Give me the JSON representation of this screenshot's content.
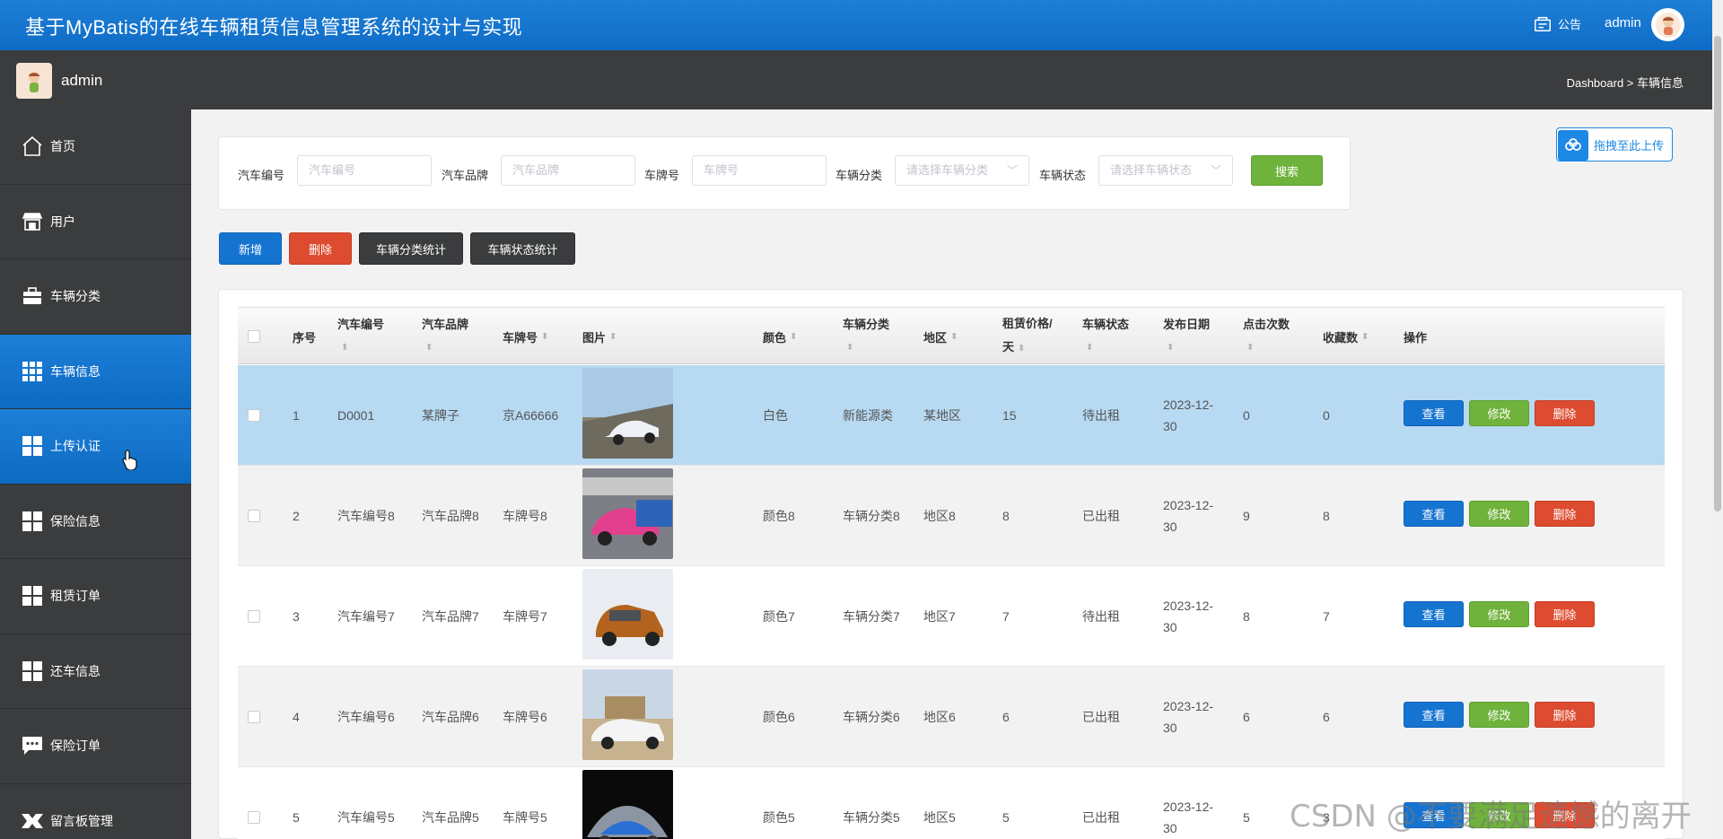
{
  "header": {
    "title": "基于MyBatis的在线车辆租赁信息管理系统的设计与实现",
    "notice_label": "公告",
    "user": "admin"
  },
  "subbar": {
    "user": "admin",
    "breadcrumb": "Dashboard > 车辆信息"
  },
  "sidebar": {
    "items": [
      {
        "label": "首页",
        "icon": "home-icon"
      },
      {
        "label": "用户",
        "icon": "store-icon"
      },
      {
        "label": "车辆分类",
        "icon": "briefcase-icon"
      },
      {
        "label": "车辆信息",
        "icon": "grid9-icon"
      },
      {
        "label": "上传认证",
        "icon": "grid4-icon"
      },
      {
        "label": "保险信息",
        "icon": "grid4-icon"
      },
      {
        "label": "租赁订单",
        "icon": "grid4-icon"
      },
      {
        "label": "还车信息",
        "icon": "grid4-icon"
      },
      {
        "label": "保险订单",
        "icon": "chat-icon"
      },
      {
        "label": "留言板管理",
        "icon": "ribbon-icon"
      }
    ],
    "active_index": 3
  },
  "upload": {
    "label": "拖拽至此上传"
  },
  "search": {
    "fields": [
      {
        "label": "汽车编号",
        "placeholder": "汽车编号"
      },
      {
        "label": "汽车品牌",
        "placeholder": "汽车品牌"
      },
      {
        "label": "车牌号",
        "placeholder": "车牌号"
      }
    ],
    "selects": [
      {
        "label": "车辆分类",
        "placeholder": "请选择车辆分类"
      },
      {
        "label": "车辆状态",
        "placeholder": "请选择车辆状态"
      }
    ],
    "button": "搜索"
  },
  "actions": {
    "add": "新增",
    "delete": "删除",
    "category_stats": "车辆分类统计",
    "status_stats": "车辆状态统计"
  },
  "colors": {
    "primary": "#1674d1",
    "success": "#6fb23c",
    "danger": "#dd4b30",
    "dark": "#3a3c3d",
    "selected_row": "#b7d9f2"
  },
  "table": {
    "headers": {
      "index": "序号",
      "car_no": "汽车编号",
      "brand": "汽车品牌",
      "plate": "车牌号",
      "image": "图片",
      "color": "颜色",
      "category": "车辆分类",
      "region": "地区",
      "price_line1": "租赁价格/",
      "price_line2": "天",
      "status": "车辆状态",
      "date": "发布日期",
      "clicks": "点击次数",
      "favorites": "收藏数",
      "ops": "操作"
    },
    "row_buttons": {
      "view": "查看",
      "edit": "修改",
      "delete": "删除"
    },
    "rows": [
      {
        "index": "1",
        "car_no": "D0001",
        "brand": "某牌子",
        "plate": "京A66666",
        "color": "白色",
        "category": "新能源类",
        "region": "某地区",
        "price": "15",
        "status": "待出租",
        "date1": "2023-12-",
        "date2": "30",
        "clicks": "0",
        "favorites": "0"
      },
      {
        "index": "2",
        "car_no": "汽车编号8",
        "brand": "汽车品牌8",
        "plate": "车牌号8",
        "color": "颜色8",
        "category": "车辆分类8",
        "region": "地区8",
        "price": "8",
        "status": "已出租",
        "date1": "2023-12-",
        "date2": "30",
        "clicks": "9",
        "favorites": "8"
      },
      {
        "index": "3",
        "car_no": "汽车编号7",
        "brand": "汽车品牌7",
        "plate": "车牌号7",
        "color": "颜色7",
        "category": "车辆分类7",
        "region": "地区7",
        "price": "7",
        "status": "待出租",
        "date1": "2023-12-",
        "date2": "30",
        "clicks": "8",
        "favorites": "7"
      },
      {
        "index": "4",
        "car_no": "汽车编号6",
        "brand": "汽车品牌6",
        "plate": "车牌号6",
        "color": "颜色6",
        "category": "车辆分类6",
        "region": "地区6",
        "price": "6",
        "status": "已出租",
        "date1": "2023-12-",
        "date2": "30",
        "clicks": "6",
        "favorites": "6"
      },
      {
        "index": "5",
        "car_no": "汽车编号5",
        "brand": "汽车品牌5",
        "plate": "车牌号5",
        "color": "颜色5",
        "category": "车辆分类5",
        "region": "地区5",
        "price": "5",
        "status": "已出租",
        "date1": "2023-12-",
        "date2": "30",
        "clicks": "5",
        "favorites": "3"
      }
    ]
  },
  "watermark": "CSDN @不要满足遗憾的离开"
}
